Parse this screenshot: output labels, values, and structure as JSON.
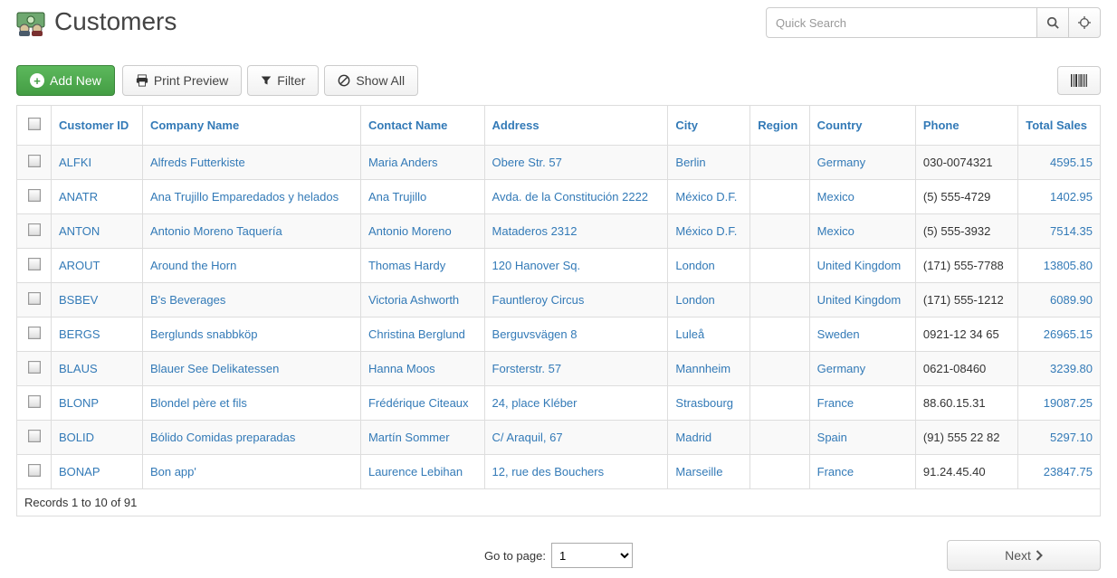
{
  "header": {
    "title": "Customers",
    "searchPlaceholder": "Quick Search"
  },
  "toolbar": {
    "addNew": "Add New",
    "printPreview": "Print Preview",
    "filter": "Filter",
    "showAll": "Show All"
  },
  "columns": {
    "customerId": "Customer ID",
    "companyName": "Company Name",
    "contactName": "Contact Name",
    "address": "Address",
    "city": "City",
    "region": "Region",
    "country": "Country",
    "phone": "Phone",
    "totalSales": "Total Sales"
  },
  "rows": [
    {
      "customerId": "ALFKI",
      "companyName": "Alfreds Futterkiste",
      "contactName": "Maria Anders",
      "address": "Obere Str. 57",
      "city": "Berlin",
      "region": "",
      "country": "Germany",
      "phone": "030-0074321",
      "totalSales": "4595.15"
    },
    {
      "customerId": "ANATR",
      "companyName": "Ana Trujillo Emparedados y helados",
      "contactName": "Ana Trujillo",
      "address": "Avda. de la Constitución 2222",
      "city": "México D.F.",
      "region": "",
      "country": "Mexico",
      "phone": "(5) 555-4729",
      "totalSales": "1402.95"
    },
    {
      "customerId": "ANTON",
      "companyName": "Antonio Moreno Taquería",
      "contactName": "Antonio Moreno",
      "address": "Mataderos 2312",
      "city": "México D.F.",
      "region": "",
      "country": "Mexico",
      "phone": "(5) 555-3932",
      "totalSales": "7514.35"
    },
    {
      "customerId": "AROUT",
      "companyName": "Around the Horn",
      "contactName": "Thomas Hardy",
      "address": "120 Hanover Sq.",
      "city": "London",
      "region": "",
      "country": "United Kingdom",
      "phone": "(171) 555-7788",
      "totalSales": "13805.80"
    },
    {
      "customerId": "BSBEV",
      "companyName": "B's Beverages",
      "contactName": "Victoria Ashworth",
      "address": "Fauntleroy Circus",
      "city": "London",
      "region": "",
      "country": "United Kingdom",
      "phone": "(171) 555-1212",
      "totalSales": "6089.90"
    },
    {
      "customerId": "BERGS",
      "companyName": "Berglunds snabbköp",
      "contactName": "Christina Berglund",
      "address": "Berguvsvägen 8",
      "city": "Luleå",
      "region": "",
      "country": "Sweden",
      "phone": "0921-12 34 65",
      "totalSales": "26965.15"
    },
    {
      "customerId": "BLAUS",
      "companyName": "Blauer See Delikatessen",
      "contactName": "Hanna Moos",
      "address": "Forsterstr. 57",
      "city": "Mannheim",
      "region": "",
      "country": "Germany",
      "phone": "0621-08460",
      "totalSales": "3239.80"
    },
    {
      "customerId": "BLONP",
      "companyName": "Blondel père et fils",
      "contactName": "Frédérique Citeaux",
      "address": "24, place Kléber",
      "city": "Strasbourg",
      "region": "",
      "country": "France",
      "phone": "88.60.15.31",
      "totalSales": "19087.25"
    },
    {
      "customerId": "BOLID",
      "companyName": "Bólido Comidas preparadas",
      "contactName": "Martín Sommer",
      "address": "C/ Araquil, 67",
      "city": "Madrid",
      "region": "",
      "country": "Spain",
      "phone": "(91) 555 22 82",
      "totalSales": "5297.10"
    },
    {
      "customerId": "BONAP",
      "companyName": "Bon app'",
      "contactName": "Laurence Lebihan",
      "address": "12, rue des Bouchers",
      "city": "Marseille",
      "region": "",
      "country": "France",
      "phone": "91.24.45.40",
      "totalSales": "23847.75"
    }
  ],
  "footer": {
    "recordsText": "Records 1 to 10 of 91"
  },
  "pager": {
    "goToPageLabel": "Go to page:",
    "currentPage": "1",
    "nextLabel": "Next"
  }
}
